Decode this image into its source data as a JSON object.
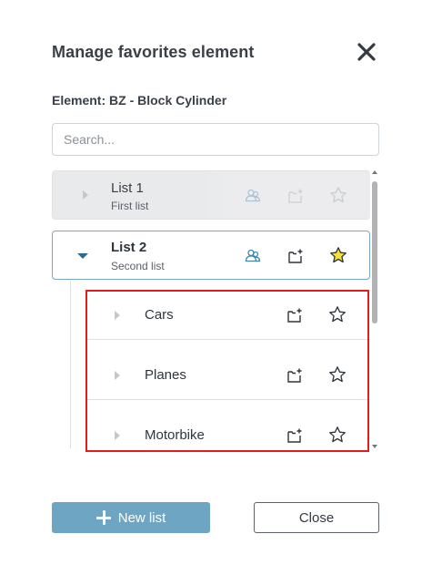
{
  "dialog": {
    "title": "Manage favorites element",
    "element_label": "Element: BZ - Block Cylinder"
  },
  "search": {
    "placeholder": "Search...",
    "value": ""
  },
  "lists": [
    {
      "name": "List 1",
      "subtitle": "First list",
      "expanded": false,
      "favorite": false,
      "state": "disabled"
    },
    {
      "name": "List 2",
      "subtitle": "Second list",
      "expanded": true,
      "favorite": true,
      "state": "active"
    }
  ],
  "children": [
    {
      "name": "Cars",
      "favorite": false
    },
    {
      "name": "Planes",
      "favorite": false
    },
    {
      "name": "Motorbike",
      "favorite": false
    }
  ],
  "footer": {
    "new_list_label": "New list",
    "close_label": "Close"
  },
  "icons": {
    "close": "close-icon",
    "share": "share-users-icon",
    "add_to_folder": "add-folder-icon",
    "favorite": "star-icon",
    "expand": "chevron-right-icon",
    "collapse": "chevron-down-icon",
    "plus": "plus-icon"
  },
  "colors": {
    "accent": "#6ea5c2",
    "selected_border": "#7aa7c5",
    "star_fill": "#f5e13b",
    "highlight": "#e11d1d",
    "chevron_active": "#2d6c8e"
  }
}
